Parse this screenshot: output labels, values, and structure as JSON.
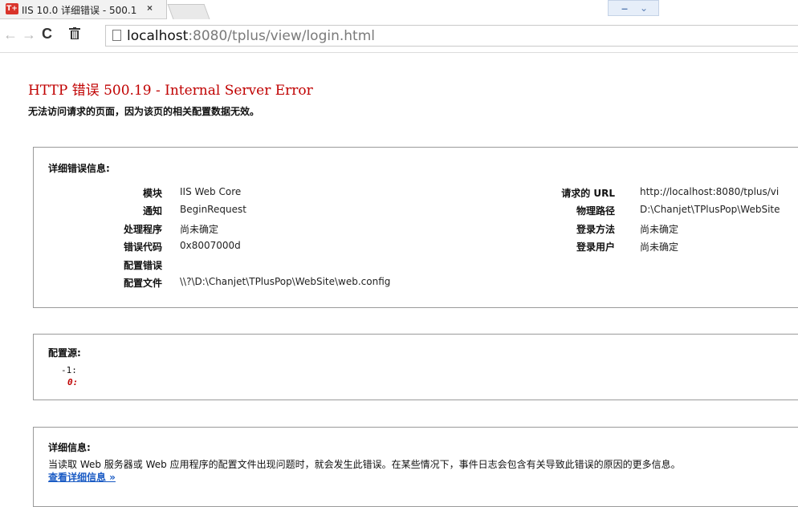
{
  "browser": {
    "tab": {
      "favicon_text": "T+",
      "title": "IIS 10.0 详细错误 - 500.1",
      "close_glyph": "×"
    },
    "window_controls": {
      "minimize": "–",
      "menu": "⌄"
    },
    "nav": {
      "back": "←",
      "forward": "→",
      "reload": "C"
    },
    "url": {
      "host": "localhost",
      "rest": ":8080/tplus/view/login.html"
    }
  },
  "page": {
    "title": "HTTP 错误 500.19 - Internal Server Error",
    "subtitle": "无法访问请求的页面，因为该页的相关配置数据无效。",
    "detail_error": {
      "heading": "详细错误信息:",
      "left": [
        {
          "label": "模块",
          "value": "IIS Web Core"
        },
        {
          "label": "通知",
          "value": "BeginRequest"
        },
        {
          "label": "处理程序",
          "value": "尚未确定"
        },
        {
          "label": "错误代码",
          "value": "0x8007000d"
        },
        {
          "label": "配置错误",
          "value": ""
        },
        {
          "label": "配置文件",
          "value": "\\\\?\\D:\\Chanjet\\TPlusPop\\WebSite\\web.config"
        }
      ],
      "right": [
        {
          "label": "请求的 URL",
          "value": "http://localhost:8080/tplus/vi"
        },
        {
          "label": "物理路径",
          "value": "D:\\Chanjet\\TPlusPop\\WebSite"
        },
        {
          "label": "登录方法",
          "value": "尚未确定"
        },
        {
          "label": "登录用户",
          "value": "尚未确定"
        }
      ]
    },
    "config_source": {
      "heading": "配置源:",
      "line1": "-1:",
      "line2": "0:"
    },
    "more_info": {
      "heading": "详细信息:",
      "text": "当读取 Web 服务器或 Web 应用程序的配置文件出现问题时，就会发生此错误。在某些情况下，事件日志会包含有关导致此错误的原因的更多信息。",
      "link": "查看详细信息 »"
    }
  },
  "colors": {
    "error_red": "#c00000",
    "link_blue": "#1a5bc4"
  }
}
